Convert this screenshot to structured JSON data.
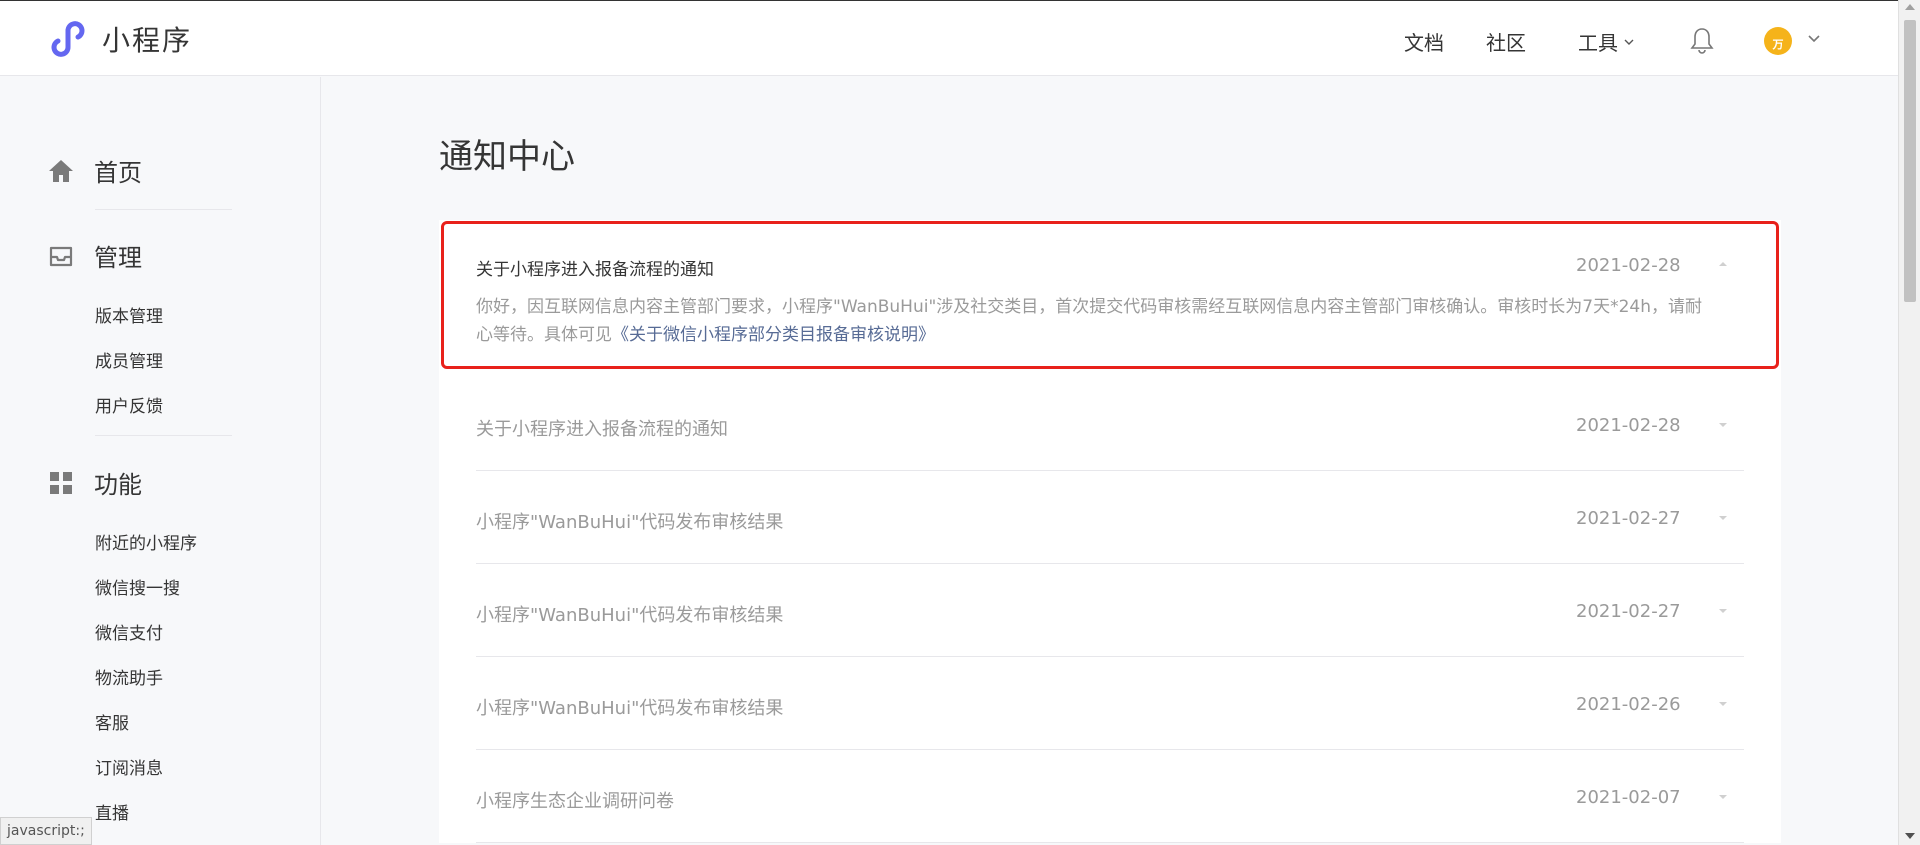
{
  "header": {
    "logo_text": "小程序",
    "nav": {
      "docs": "文档",
      "community": "社区",
      "tools": "工具"
    },
    "avatar_text": "万"
  },
  "sidebar": {
    "home": "首页",
    "manage": "管理",
    "manage_items": [
      "版本管理",
      "成员管理",
      "用户反馈"
    ],
    "features": "功能",
    "feature_items": [
      "附近的小程序",
      "微信搜一搜",
      "微信支付",
      "物流助手",
      "客服",
      "订阅消息",
      "直播"
    ]
  },
  "page": {
    "title": "通知中心"
  },
  "notices": {
    "expanded": {
      "title": "关于小程序进入报备流程的通知",
      "date": "2021-02-28",
      "body": "你好，因互联网信息内容主管部门要求，小程序\"WanBuHui\"涉及社交类目，首次提交代码审核需经互联网信息内容主管部门审核确认。审核时长为7天*24h，请耐心等待。具体可见",
      "link": "《关于微信小程序部分类目报备审核说明》"
    },
    "rows": [
      {
        "title": "关于小程序进入报备流程的通知",
        "date": "2021-02-28"
      },
      {
        "title": "小程序\"WanBuHui\"代码发布审核结果",
        "date": "2021-02-27"
      },
      {
        "title": "小程序\"WanBuHui\"代码发布审核结果",
        "date": "2021-02-27"
      },
      {
        "title": "小程序\"WanBuHui\"代码发布审核结果",
        "date": "2021-02-26"
      },
      {
        "title": "小程序生态企业调研问卷",
        "date": "2021-02-07"
      }
    ]
  },
  "status_bar": "javascript:;",
  "colors": {
    "accent": "#6467f0",
    "highlight": "#e8211b",
    "link": "#576b95"
  }
}
